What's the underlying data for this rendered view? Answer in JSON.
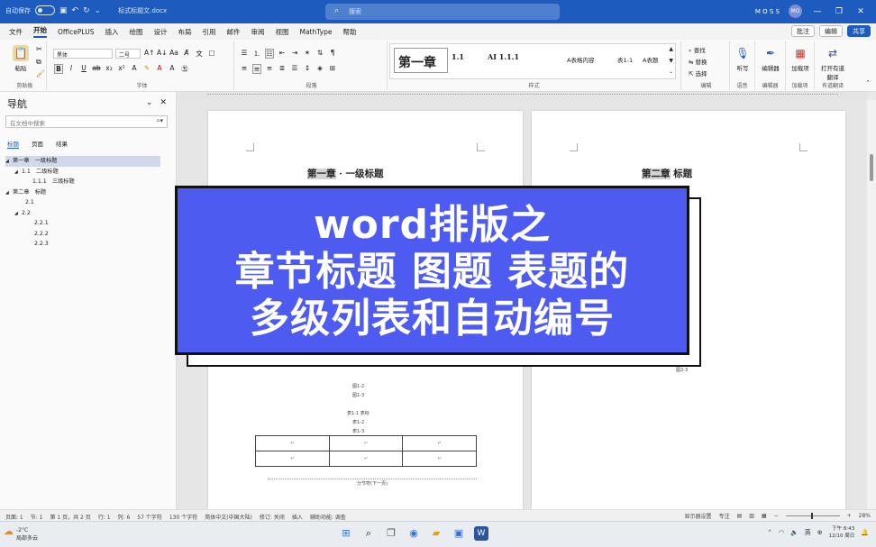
{
  "titlebar": {
    "autosave_label": "自动保存",
    "doc_name": "标式标题文.docx",
    "search_placeholder": "搜索",
    "user_name": "M O S S",
    "user_initials": "MO"
  },
  "ribbon_tabs": [
    "文件",
    "开始",
    "OfficePLUS",
    "插入",
    "绘图",
    "设计",
    "布局",
    "引用",
    "邮件",
    "审阅",
    "视图",
    "MathType",
    "帮助"
  ],
  "ribbon_actions": {
    "comment": "批注",
    "edit": "编辑",
    "share": "共享"
  },
  "ribbon": {
    "paste_label": "粘贴",
    "font_name": "黑体",
    "font_size": "二号",
    "group_labels": {
      "clipboard": "剪贴板",
      "font": "字体",
      "paragraph": "段落",
      "styles": "样式",
      "editing": "编辑",
      "voice": "语音",
      "editor": "编辑器",
      "addins": "加载项",
      "translate": "有道翻译"
    },
    "styles": [
      "第一章",
      "1.1",
      "AI 1.1.1",
      "A表格内容",
      "表1-1",
      "A表题"
    ],
    "editing_items": [
      "查找",
      "替换",
      "选择"
    ],
    "right_buttons": [
      "听写",
      "编辑器",
      "加载项",
      "打开有道翻译"
    ]
  },
  "nav": {
    "title": "导航",
    "search_placeholder": "在文档中搜索",
    "tabs": [
      "标题",
      "页面",
      "结果"
    ],
    "tree": [
      {
        "text": "第一章　一级标题",
        "selected": true,
        "arrow": "◢"
      },
      {
        "text": "1.1　二级标题",
        "selected": false,
        "arrow": "◢"
      },
      {
        "text": "1.1.1　三级标题",
        "selected": false,
        "arrow": ""
      },
      {
        "text": "第二章　标题",
        "selected": false,
        "arrow": "◢"
      },
      {
        "text": "2.1",
        "selected": false,
        "arrow": ""
      },
      {
        "text": "2.2",
        "selected": false,
        "arrow": "◢"
      },
      {
        "text": "2.2.1",
        "selected": false,
        "arrow": ""
      },
      {
        "text": "2.2.2",
        "selected": false,
        "arrow": ""
      },
      {
        "text": "2.2.3",
        "selected": false,
        "arrow": ""
      }
    ]
  },
  "document": {
    "page1_heading_num": "第一章",
    "page1_heading_text": "一级标题",
    "page2_heading_num": "第二章",
    "page2_heading_text": "标题",
    "figure_captions": [
      "图1-2",
      "图1-3"
    ],
    "table_captions": [
      "表1-1 表标",
      "表1-2",
      "表1-3"
    ],
    "page2_caption": "图2-3",
    "section_break": "分节符(下一页)"
  },
  "overlay": {
    "line1": "word排版之",
    "line2": "章节标题 图题 表题的",
    "line3": "多级列表和自动编号"
  },
  "statusbar": {
    "page": "页面: 1",
    "section": "节: 1",
    "page_of": "第 1 页，共 2 页",
    "line": "行: 1",
    "column": "列: 6",
    "chars_selected": "57 个字符",
    "chars_total": "130 个字符",
    "language": "简体中文(中国大陆)",
    "track": "修订: 关闭",
    "insert": "插入",
    "accessibility": "辅助功能: 调查",
    "display": "显示器设置",
    "focus": "专注",
    "zoom": "28%"
  },
  "taskbar": {
    "temp": "-2°C",
    "weather": "局部多云",
    "lang": "英",
    "time": "下午 8:43",
    "date": "12/10 周日"
  },
  "colors": {
    "accent": "#1d5bbe",
    "banner": "#4e5bf0"
  }
}
